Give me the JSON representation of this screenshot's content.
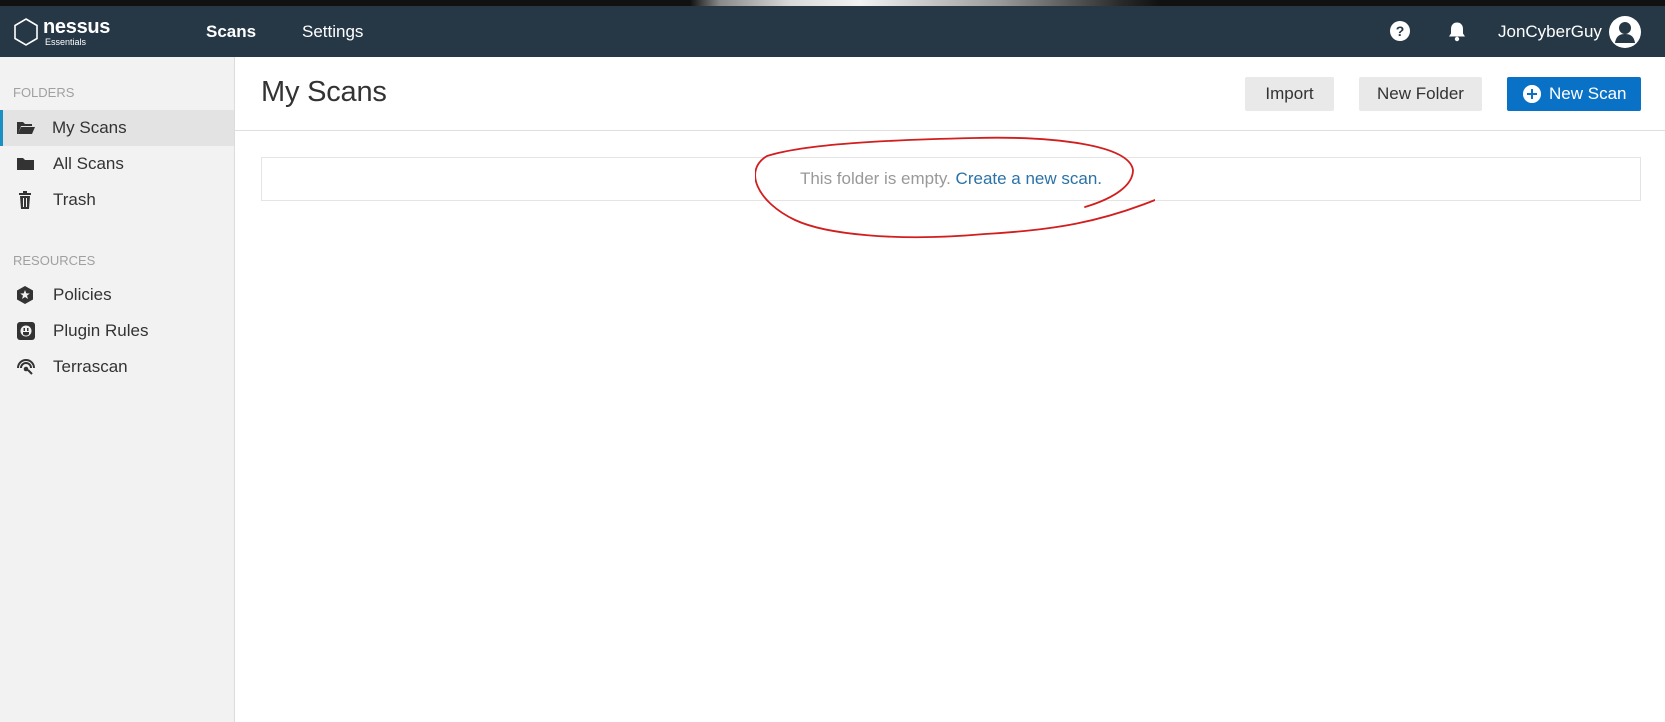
{
  "brand": {
    "name": "nessus",
    "edition": "Essentials"
  },
  "nav": {
    "items": [
      {
        "label": "Scans"
      },
      {
        "label": "Settings"
      }
    ],
    "help_glyph": "?",
    "username": "JonCyberGuy",
    "icons": [
      "help-icon",
      "bell-icon",
      "user-avatar-icon"
    ]
  },
  "sidebar": {
    "folders_heading": "FOLDERS",
    "folders": [
      {
        "label": "My Scans",
        "icon": "folder-open-icon",
        "active": true
      },
      {
        "label": "All Scans",
        "icon": "folder-icon",
        "active": false
      },
      {
        "label": "Trash",
        "icon": "trash-icon",
        "active": false
      }
    ],
    "resources_heading": "RESOURCES",
    "resources": [
      {
        "label": "Policies",
        "icon": "shield-star-icon"
      },
      {
        "label": "Plugin Rules",
        "icon": "plugin-icon"
      },
      {
        "label": "Terrascan",
        "icon": "radar-icon"
      }
    ]
  },
  "main": {
    "title": "My Scans",
    "buttons": {
      "import": "Import",
      "new_folder": "New Folder",
      "new_scan": "New Scan"
    },
    "empty_message": "This folder is empty.",
    "empty_link": "Create a new scan",
    "empty_link_suffix": "."
  },
  "colors": {
    "navbar": "#263746",
    "primary_button": "#0a72c6",
    "active_accent": "#1a8fc4",
    "link": "#2a72a8",
    "annotation": "#d21e1e"
  }
}
